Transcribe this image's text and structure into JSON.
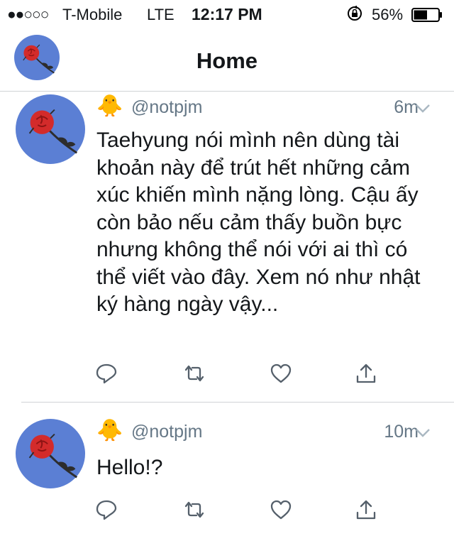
{
  "status_bar": {
    "signal": "●●○○○",
    "carrier": "T-Mobile",
    "network": "LTE",
    "time": "12:17 PM",
    "battery_percent": "56%",
    "battery_level": 0.56
  },
  "nav": {
    "title": "Home"
  },
  "tweets": [
    {
      "emoji": "🐥",
      "handle": "@notpjm",
      "time": "6m",
      "text": "Taehyung nói mình nên dùng tài khoản này để trút hết những cảm xúc khiến mình nặng lòng. Cậu ấy còn bảo nếu cảm thấy buồn bực nhưng không thể nói với ai thì có thể viết vào đây. Xem nó như nhật ký hàng ngày vậy..."
    },
    {
      "emoji": "🐥",
      "handle": "@notpjm",
      "time": "10m",
      "text": "Hello!?"
    }
  ],
  "colors": {
    "avatar_bg": "#5b7fd4",
    "rose": "#d32b2b",
    "muted": "#657786",
    "icon": "#55606b"
  }
}
